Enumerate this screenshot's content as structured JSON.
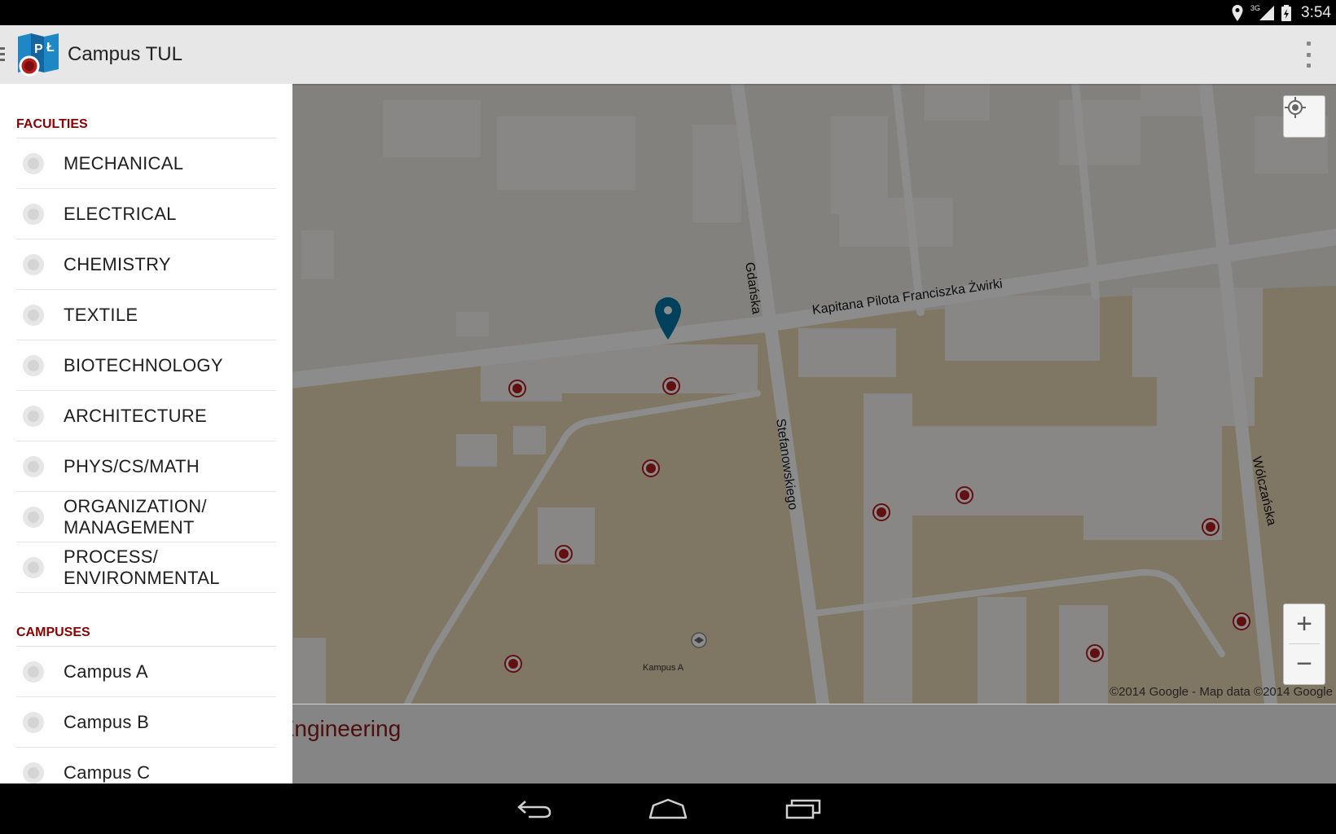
{
  "status_bar": {
    "time": "3:54",
    "network": "3G"
  },
  "app_bar": {
    "title": "Campus TUL",
    "logo_text_left": "P",
    "logo_text_right": "Ł"
  },
  "drawer": {
    "faculties_header": "FACULTIES",
    "faculties": [
      {
        "label": "MECHANICAL"
      },
      {
        "label": "ELECTRICAL"
      },
      {
        "label": "CHEMISTRY"
      },
      {
        "label": "TEXTILE"
      },
      {
        "label": "BIOTECHNOLOGY"
      },
      {
        "label": "ARCHITECTURE"
      },
      {
        "label": "PHYS/CS/MATH"
      },
      {
        "label": "ORGANIZATION/\nMANAGEMENT"
      },
      {
        "label": "PROCESS/\nENVIRONMENTAL"
      }
    ],
    "campuses_header": "CAMPUSES",
    "campuses": [
      {
        "label": "Campus A"
      },
      {
        "label": "Campus B"
      },
      {
        "label": "Campus C"
      }
    ]
  },
  "map": {
    "streets": {
      "gdanska": "Gdańska",
      "zwirki": "Kapitana Pilota Franciszka Żwirki",
      "stefanowskiego": "Stefanowskiego",
      "wolczanska": "Wólczańska"
    },
    "poi_label": "Kampus A",
    "attribution": "©2014 Google - Map data ©2014 Google",
    "zoom_in": "+",
    "zoom_out": "−"
  },
  "info_panel": {
    "title": "ty of Engineering"
  },
  "colors": {
    "accent": "#8b0000",
    "marker": "#0277a8",
    "poi_marker": "#b71c1c"
  }
}
